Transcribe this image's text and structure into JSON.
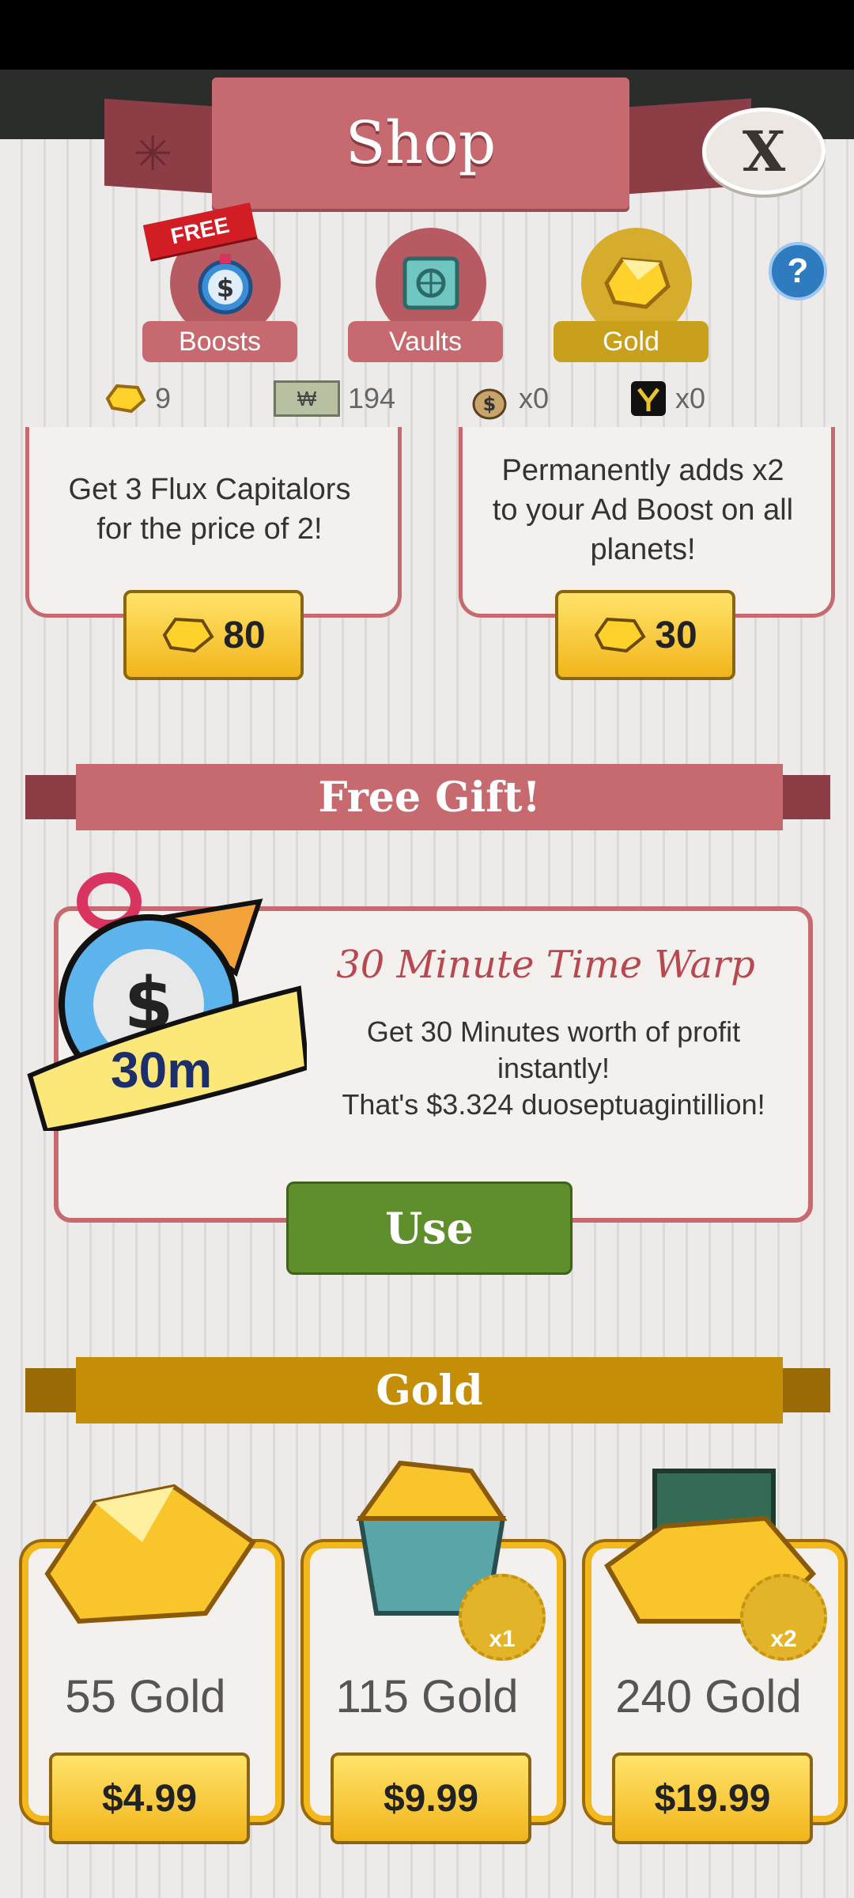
{
  "header": {
    "title": "Shop",
    "close_label": "X"
  },
  "tabs": [
    {
      "label": "Boosts",
      "badge": "FREE"
    },
    {
      "label": "Vaults"
    },
    {
      "label": "Gold",
      "active": true
    }
  ],
  "help_label": "?",
  "currencies": [
    {
      "icon": "gold-gem-icon",
      "value": "9"
    },
    {
      "icon": "megabucks-bill-icon",
      "value": "194",
      "symbol": "₩"
    },
    {
      "icon": "money-bag-icon",
      "value": "x0"
    },
    {
      "icon": "flux-icon",
      "value": "x0"
    }
  ],
  "offers": [
    {
      "description": [
        "Get 3 Flux Capitalors",
        "for the price of 2!"
      ],
      "price": "80"
    },
    {
      "description": [
        "Permanently adds x2",
        "to your Ad Boost on all",
        "planets!"
      ],
      "price": "30"
    }
  ],
  "free_gift": {
    "section_title": "Free Gift!",
    "badge": "30m",
    "title": "30 Minute Time Warp",
    "description": [
      "Get 30 Minutes worth of profit",
      "instantly!",
      "That's $3.324 duoseptuagintillion!"
    ],
    "button": "Use"
  },
  "gold_section": {
    "title": "Gold",
    "packs": [
      {
        "name": "55 Gold",
        "price": "$4.99",
        "multiplier": ""
      },
      {
        "name": "115 Gold",
        "price": "$9.99",
        "multiplier": "x1"
      },
      {
        "name": "240 Gold",
        "price": "$19.99",
        "multiplier": "x2"
      }
    ]
  },
  "colors": {
    "shop_red": "#c76a70",
    "gold_accent": "#c9a01c",
    "use_green": "#5f8e2d"
  }
}
